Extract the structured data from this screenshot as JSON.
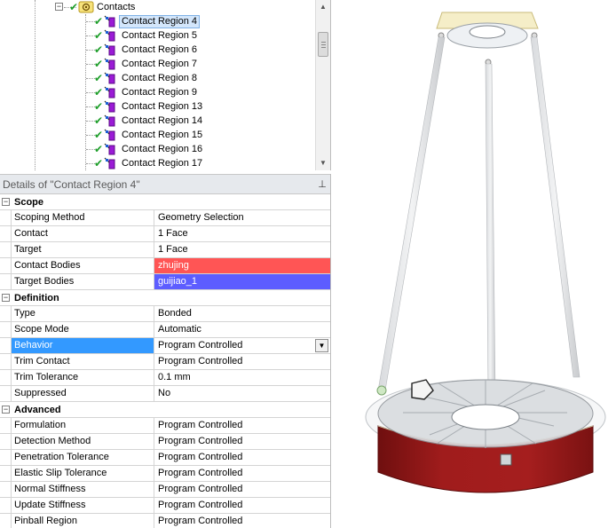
{
  "tree": {
    "parent": {
      "label": "Contacts",
      "icon": "contacts-folder-icon"
    },
    "items": [
      {
        "label": "Contact Region 4",
        "selected": true
      },
      {
        "label": "Contact Region 5"
      },
      {
        "label": "Contact Region 6"
      },
      {
        "label": "Contact Region 7"
      },
      {
        "label": "Contact Region 8"
      },
      {
        "label": "Contact Region 9"
      },
      {
        "label": "Contact Region 13"
      },
      {
        "label": "Contact Region 14"
      },
      {
        "label": "Contact Region 15"
      },
      {
        "label": "Contact Region 16"
      },
      {
        "label": "Contact Region 17"
      }
    ],
    "expander_symbol": "−",
    "check_symbol": "✔"
  },
  "details": {
    "title": "Details of \"Contact Region 4\"",
    "pin_icon": "pin-icon",
    "groups": [
      {
        "label": "Scope",
        "rows": [
          {
            "name": "Scoping Method",
            "value": "Geometry Selection"
          },
          {
            "name": "Contact",
            "value": "1 Face"
          },
          {
            "name": "Target",
            "value": "1 Face"
          },
          {
            "name": "Contact Bodies",
            "value": "zhujing",
            "highlight": "red"
          },
          {
            "name": "Target Bodies",
            "value": "guijiao_1",
            "highlight": "blue"
          }
        ]
      },
      {
        "label": "Definition",
        "rows": [
          {
            "name": "Type",
            "value": "Bonded"
          },
          {
            "name": "Scope Mode",
            "value": "Automatic"
          },
          {
            "name": "Behavior",
            "value": "Program Controlled",
            "selected": true,
            "dropdown": true
          },
          {
            "name": "Trim Contact",
            "value": "Program Controlled"
          },
          {
            "name": "Trim Tolerance",
            "value": "0.1 mm"
          },
          {
            "name": "Suppressed",
            "value": "No"
          }
        ]
      },
      {
        "label": "Advanced",
        "rows": [
          {
            "name": "Formulation",
            "value": "Program Controlled"
          },
          {
            "name": "Detection Method",
            "value": "Program Controlled"
          },
          {
            "name": "Penetration Tolerance",
            "value": "Program Controlled"
          },
          {
            "name": "Elastic Slip Tolerance",
            "value": "Program Controlled"
          },
          {
            "name": "Normal Stiffness",
            "value": "Program Controlled"
          },
          {
            "name": "Update Stiffness",
            "value": "Program Controlled"
          },
          {
            "name": "Pinball Region",
            "value": "Program Controlled"
          }
        ]
      }
    ],
    "collapse_symbol": "−",
    "dropdown_symbol": "▼"
  },
  "colors": {
    "contact_bodies": "#ff5555",
    "target_bodies": "#5d5dff",
    "selection": "#3399ff",
    "model_red": "#9b1a1a",
    "check_green": "#1e9e2a"
  }
}
